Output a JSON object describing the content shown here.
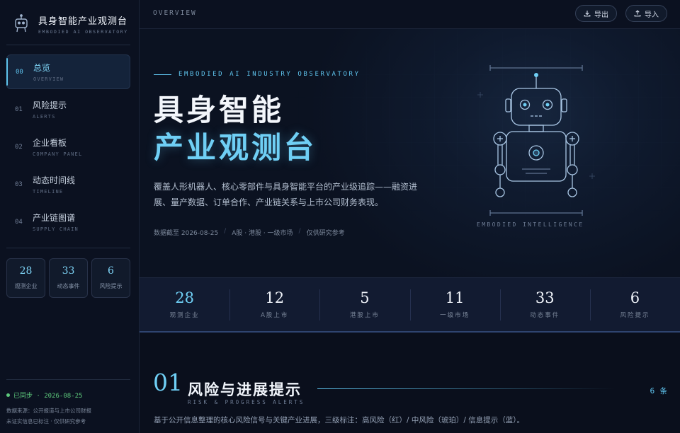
{
  "brand": {
    "title": "具身智能产业观测台",
    "subtitle": "EMBODIED AI OBSERVATORY",
    "logo_icon": "robot-icon"
  },
  "nav": {
    "items": [
      {
        "num": "00",
        "label": "总览",
        "sub": "OVERVIEW",
        "active": true
      },
      {
        "num": "01",
        "label": "风险提示",
        "sub": "ALERTS",
        "active": false
      },
      {
        "num": "02",
        "label": "企业看板",
        "sub": "COMPANY PANEL",
        "active": false
      },
      {
        "num": "03",
        "label": "动态时间线",
        "sub": "TIMELINE",
        "active": false
      },
      {
        "num": "04",
        "label": "产业链图谱",
        "sub": "SUPPLY CHAIN",
        "active": false
      }
    ]
  },
  "mini_stats": [
    {
      "value": "28",
      "label": "观测企业"
    },
    {
      "value": "33",
      "label": "动态事件"
    },
    {
      "value": "6",
      "label": "风险提示"
    }
  ],
  "sidebar_footer": {
    "sync_status": "已同步 · 2026-08-25",
    "source_line1": "数据来源：公开报道与上市公司财报",
    "source_line2": "未证实信息已标注 · 仅供研究参考"
  },
  "topbar": {
    "breadcrumb": "OVERVIEW",
    "export_label": "导出",
    "import_label": "导入"
  },
  "hero": {
    "eyebrow": "EMBODIED AI INDUSTRY OBSERVATORY",
    "title_line1": "具身智能",
    "title_line2": "产业观测台",
    "description": "覆盖人形机器人、核心零部件与具身智能平台的产业级追踪——融资进展、量产数据、订单合作、产业链关系与上市公司财务表现。",
    "meta_date": "数据截至 2026-08-25",
    "meta_markets": "A股 · 港股 · 一级市场",
    "meta_note": "仅供研究参考",
    "robot_caption": "EMBODIED INTELLIGENCE"
  },
  "stats": [
    {
      "value": "28",
      "label": "观测企业",
      "accent": true
    },
    {
      "value": "12",
      "label": "A股上市",
      "accent": false
    },
    {
      "value": "5",
      "label": "港股上市",
      "accent": false
    },
    {
      "value": "11",
      "label": "一级市场",
      "accent": false
    },
    {
      "value": "33",
      "label": "动态事件",
      "accent": false
    },
    {
      "value": "6",
      "label": "风险提示",
      "accent": false
    }
  ],
  "section": {
    "number": "01",
    "title": "风险与进展提示",
    "subtitle": "RISK & PROGRESS ALERTS",
    "count": "6 条",
    "description": "基于公开信息整理的核心风险信号与关键产业进展，三级标注：高风险（红）/ 中风险（琥珀）/ 信息提示（蓝）。"
  },
  "colors": {
    "accent": "#5fc4ee",
    "background": "#0a0f1c",
    "sync_green": "#5dc97c"
  }
}
